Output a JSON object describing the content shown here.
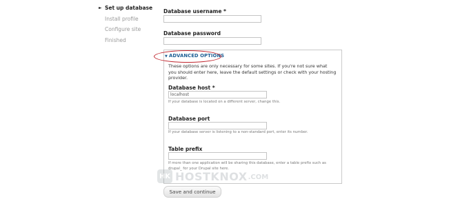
{
  "steps": [
    {
      "label": "Set up database",
      "active": true
    },
    {
      "label": "Install profile",
      "active": false
    },
    {
      "label": "Configure site",
      "active": false
    },
    {
      "label": "Finished",
      "active": false
    }
  ],
  "form": {
    "db_username_label": "Database username",
    "db_username_value": "",
    "db_password_label": "Database password",
    "db_password_value": "",
    "required_marker": "*"
  },
  "advanced": {
    "legend": "ADVANCED OPTIONS",
    "intro": "These options are only necessary for some sites. If you're not sure what you should enter here, leave the default settings or check with your hosting provider.",
    "host_label": "Database host",
    "host_value": "localhost",
    "host_desc": "If your database is located on a different server, change this.",
    "port_label": "Database port",
    "port_value": "",
    "port_desc": "If your database server is listening to a non-standard port, enter its number.",
    "prefix_label": "Table prefix",
    "prefix_value": "",
    "prefix_desc": "If more than one application will be sharing this database, enter a table prefix such as drupal_ for your Drupal site here."
  },
  "watermark": {
    "badge": "HK",
    "text": "HOSTKNOX",
    "suffix": ".COM"
  },
  "submit_label": "Save and continue",
  "colors": {
    "legend": "#1c5e94",
    "highlight_ring": "#c0242c",
    "border": "#c9c9c9"
  }
}
